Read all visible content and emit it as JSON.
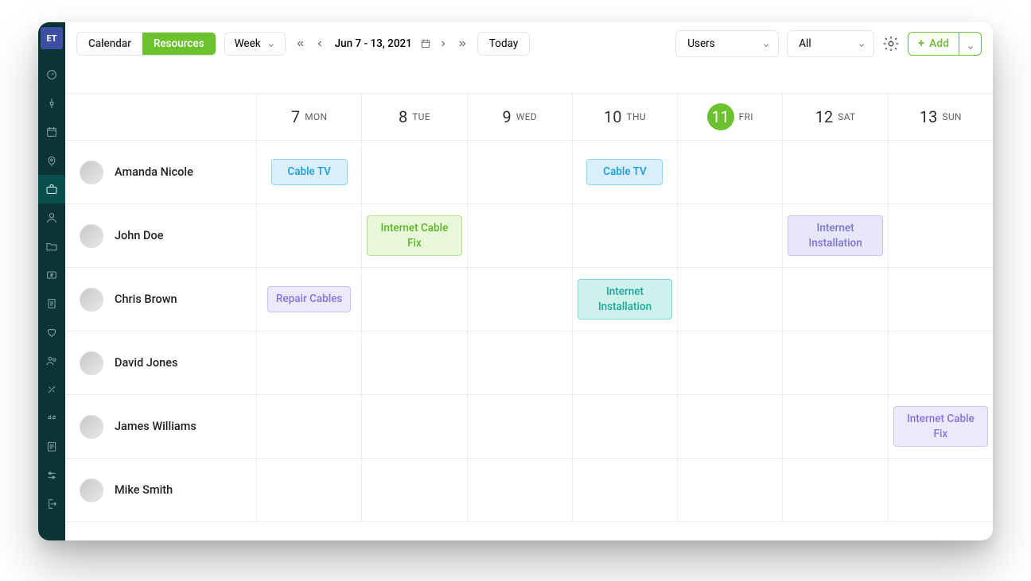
{
  "app": {
    "logo": "ET"
  },
  "sidebar_icons": [
    "dashboard",
    "pin",
    "calendar",
    "map",
    "briefcase",
    "person",
    "folder",
    "dollar",
    "doc",
    "heart",
    "people",
    "tools",
    "quote",
    "clipboard",
    "settings2",
    "logout"
  ],
  "toolbar": {
    "tab_calendar": "Calendar",
    "tab_resources": "Resources",
    "view_label": "Week",
    "date_range": "Jun 7 - 13, 2021",
    "today": "Today",
    "select_users": "Users",
    "select_all": "All",
    "add_label": "Add"
  },
  "days": [
    {
      "num": "7",
      "dow": "MON",
      "today": false
    },
    {
      "num": "8",
      "dow": "TUE",
      "today": false
    },
    {
      "num": "9",
      "dow": "WED",
      "today": false
    },
    {
      "num": "10",
      "dow": "THU",
      "today": false
    },
    {
      "num": "11",
      "dow": "FRI",
      "today": true
    },
    {
      "num": "12",
      "dow": "SAT",
      "today": false
    },
    {
      "num": "13",
      "dow": "SUN",
      "today": false
    }
  ],
  "people": [
    {
      "name": "Amanda Nicole",
      "events": [
        {
          "day": 0,
          "label": "Cable TV",
          "style": "ev-blue"
        },
        {
          "day": 3,
          "label": "Cable TV",
          "style": "ev-blue"
        }
      ]
    },
    {
      "name": "John Doe",
      "events": [
        {
          "day": 1,
          "label": "Internet Cable Fix",
          "style": "ev-green"
        },
        {
          "day": 5,
          "label": "Internet Installation",
          "style": "ev-purple"
        }
      ]
    },
    {
      "name": "Chris Brown",
      "events": [
        {
          "day": 0,
          "label": "Repair Cables",
          "style": "ev-lav"
        },
        {
          "day": 3,
          "label": "Internet Installation",
          "style": "ev-teal"
        }
      ]
    },
    {
      "name": "David Jones",
      "events": []
    },
    {
      "name": "James Williams",
      "events": [
        {
          "day": 6,
          "label": "Internet Cable Fix",
          "style": "ev-lav"
        }
      ]
    },
    {
      "name": "Mike Smith",
      "events": []
    }
  ]
}
